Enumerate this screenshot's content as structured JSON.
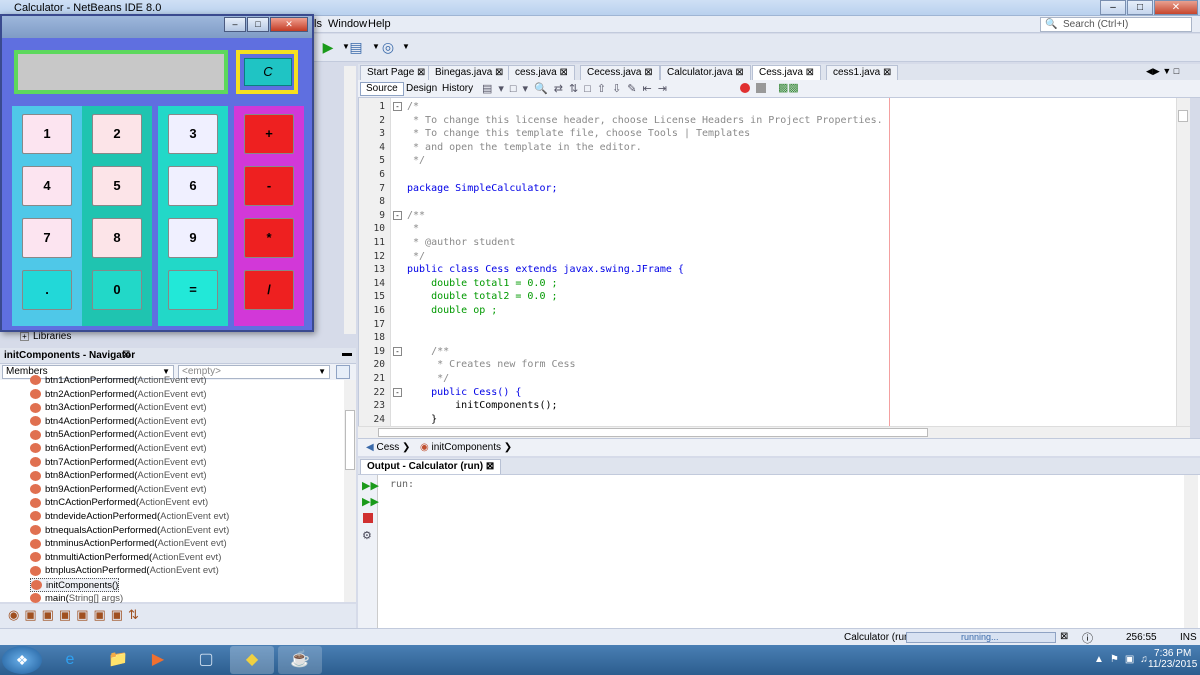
{
  "ide": {
    "title": "Calculator - NetBeans IDE 8.0",
    "menu": [
      "ls",
      "Window",
      "Help"
    ],
    "search_placeholder": "Search (Ctrl+I)"
  },
  "tabs": [
    "Start Page",
    "Binegas.java",
    "cess.java",
    "Cecess.java",
    "Calculator.java",
    "Cess.java",
    "cess1.java"
  ],
  "active_tab": "Cess.java",
  "editor_buttons": [
    "Source",
    "Design",
    "History"
  ],
  "code_lines": [
    {
      "n": "1",
      "t": "/*",
      "c": "cm"
    },
    {
      "n": "2",
      "t": " * To change this license header, choose License Headers in Project Properties.",
      "c": "cm"
    },
    {
      "n": "3",
      "t": " * To change this template file, choose Tools | Templates",
      "c": "cm"
    },
    {
      "n": "4",
      "t": " * and open the template in the editor.",
      "c": "cm"
    },
    {
      "n": "5",
      "t": " */",
      "c": "cm"
    },
    {
      "n": "6",
      "t": "",
      "c": "nm"
    },
    {
      "n": "7",
      "t": "package SimpleCalculator;",
      "c": "pk"
    },
    {
      "n": "8",
      "t": "",
      "c": "nm"
    },
    {
      "n": "9",
      "t": "/**",
      "c": "cm"
    },
    {
      "n": "10",
      "t": " *",
      "c": "cm"
    },
    {
      "n": "11",
      "t": " * @author student",
      "c": "cm"
    },
    {
      "n": "12",
      "t": " */",
      "c": "cm"
    },
    {
      "n": "13",
      "t": "public class Cess extends javax.swing.JFrame {",
      "c": "cls"
    },
    {
      "n": "14",
      "t": "    double total1 = 0.0 ;",
      "c": "fld"
    },
    {
      "n": "15",
      "t": "    double total2 = 0.0 ;",
      "c": "fld"
    },
    {
      "n": "16",
      "t": "    double op ;",
      "c": "fld"
    },
    {
      "n": "17",
      "t": "",
      "c": "nm"
    },
    {
      "n": "18",
      "t": "",
      "c": "nm"
    },
    {
      "n": "19",
      "t": "    /**",
      "c": "cm"
    },
    {
      "n": "20",
      "t": "     * Creates new form Cess",
      "c": "cm"
    },
    {
      "n": "21",
      "t": "     */",
      "c": "cm"
    },
    {
      "n": "22",
      "t": "    public Cess() {",
      "c": "ctor"
    },
    {
      "n": "23",
      "t": "        initComponents();",
      "c": "nm"
    },
    {
      "n": "24",
      "t": "    }",
      "c": "nm"
    }
  ],
  "breadcrumb": [
    "Cess",
    "initComponents"
  ],
  "output": {
    "title": "Output - Calculator (run)",
    "text": "run:"
  },
  "navigator": {
    "title": "initComponents - Navigator",
    "members_label": "Members",
    "filter": "<empty>",
    "libraries": "Libraries",
    "items": [
      {
        "name": "btn1ActionPerformed(",
        "param": "ActionEvent evt)"
      },
      {
        "name": "btn2ActionPerformed(",
        "param": "ActionEvent evt)"
      },
      {
        "name": "btn3ActionPerformed(",
        "param": "ActionEvent evt)"
      },
      {
        "name": "btn4ActionPerformed(",
        "param": "ActionEvent evt)"
      },
      {
        "name": "btn5ActionPerformed(",
        "param": "ActionEvent evt)"
      },
      {
        "name": "btn6ActionPerformed(",
        "param": "ActionEvent evt)"
      },
      {
        "name": "btn7ActionPerformed(",
        "param": "ActionEvent evt)"
      },
      {
        "name": "btn8ActionPerformed(",
        "param": "ActionEvent evt)"
      },
      {
        "name": "btn9ActionPerformed(",
        "param": "ActionEvent evt)"
      },
      {
        "name": "btnCActionPerformed(",
        "param": "ActionEvent evt)"
      },
      {
        "name": "btndevideActionPerformed(",
        "param": "ActionEvent evt)"
      },
      {
        "name": "btnequalsActionPerformed(",
        "param": "ActionEvent evt)"
      },
      {
        "name": "btnminusActionPerformed(",
        "param": "ActionEvent evt)"
      },
      {
        "name": "btnmultiActionPerformed(",
        "param": "ActionEvent evt)"
      },
      {
        "name": "btnplusActionPerformed(",
        "param": "ActionEvent evt)"
      },
      {
        "name": "initComponents()",
        "param": ""
      },
      {
        "name": "main(",
        "param": "String[] args)"
      }
    ]
  },
  "status": {
    "run_label": "Calculator (run)",
    "progress_text": "running...",
    "position": "256:55",
    "mode": "INS"
  },
  "clock": {
    "time": "7:36 PM",
    "date": "11/23/2015"
  },
  "calc": {
    "clear": "C",
    "col1": [
      "1",
      "4",
      "7",
      "."
    ],
    "col2": [
      "2",
      "5",
      "8",
      "0"
    ],
    "col3": [
      "3",
      "6",
      "9",
      "="
    ],
    "col4": [
      "+",
      "-",
      "*",
      "/"
    ]
  },
  "colors": {
    "col1": "#4fc8e8",
    "col2": "#1fc4b0",
    "col3": "#22d8c8",
    "col4": "#d238d8",
    "opkey": "#ee2020"
  }
}
